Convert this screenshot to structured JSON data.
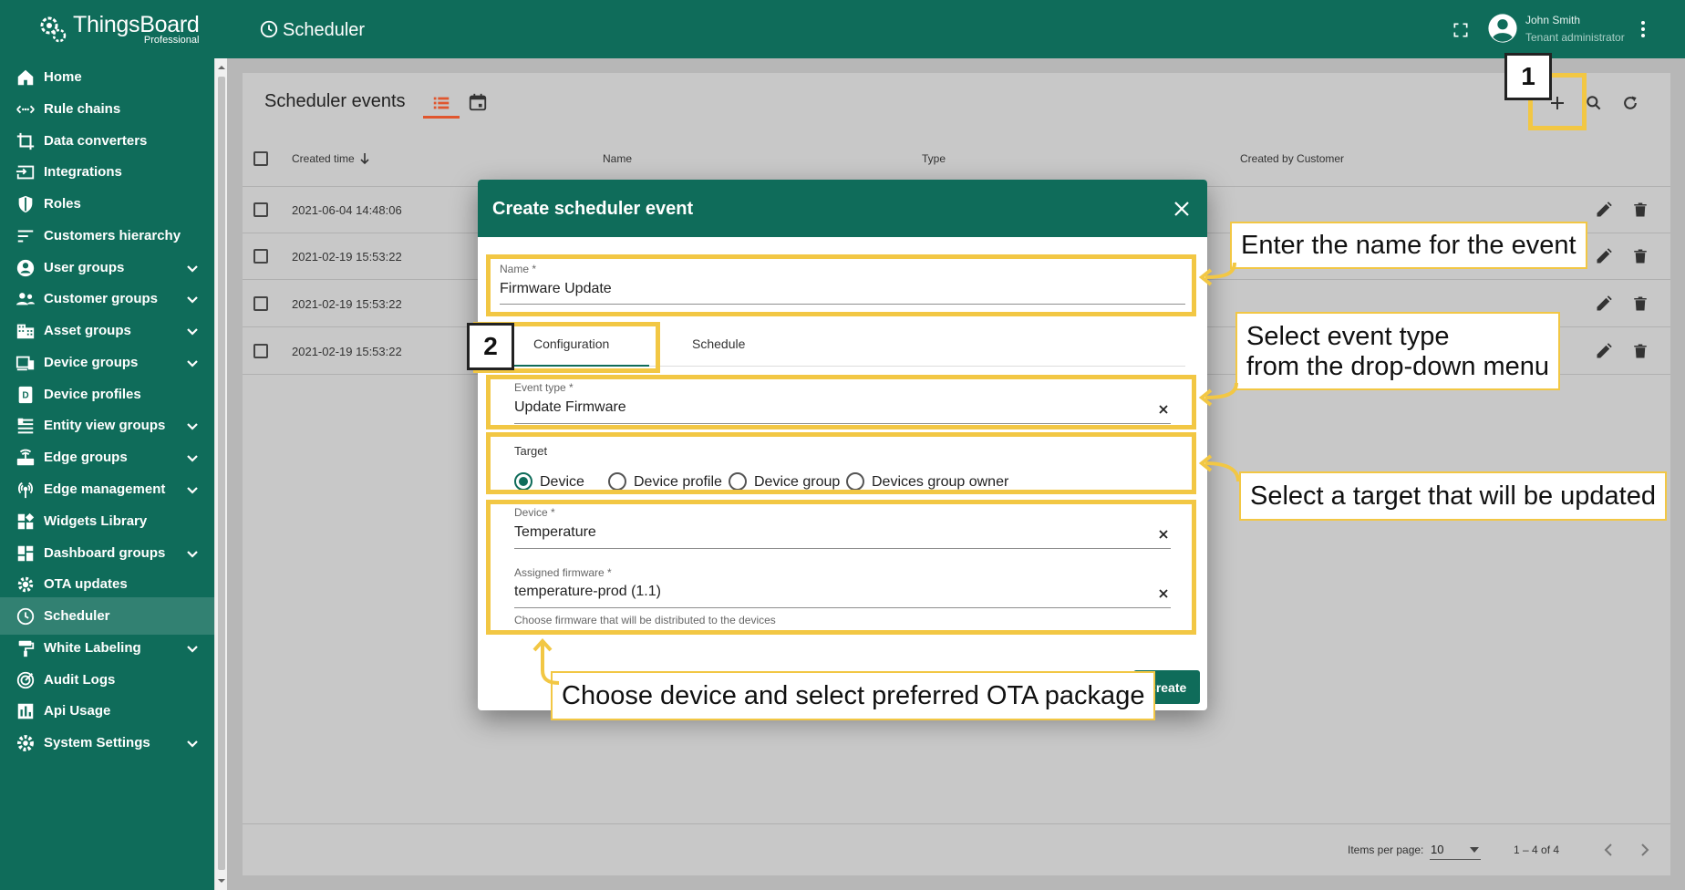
{
  "app": {
    "logo_name": "ThingsBoard",
    "logo_edition": "Professional",
    "page_title": "Scheduler",
    "user_name": "John Smith",
    "user_role": "Tenant administrator"
  },
  "sidebar": {
    "items": [
      {
        "label": "Home",
        "icon": "home-icon"
      },
      {
        "label": "Rule chains",
        "icon": "rule-chains-icon"
      },
      {
        "label": "Data converters",
        "icon": "crop-icon"
      },
      {
        "label": "Integrations",
        "icon": "input-icon"
      },
      {
        "label": "Roles",
        "icon": "shield-icon"
      },
      {
        "label": "Customers hierarchy",
        "icon": "sort-icon"
      },
      {
        "label": "User groups",
        "icon": "account-circle-icon"
      },
      {
        "label": "Customer groups",
        "icon": "supervisor-icon"
      },
      {
        "label": "Asset groups",
        "icon": "domain-icon"
      },
      {
        "label": "Device groups",
        "icon": "devices-icon"
      },
      {
        "label": "Device profiles",
        "icon": "device-profile-icon"
      },
      {
        "label": "Entity view groups",
        "icon": "view-quilt-icon"
      },
      {
        "label": "Edge groups",
        "icon": "router-icon"
      },
      {
        "label": "Edge management",
        "icon": "settings-input-antenna-icon"
      },
      {
        "label": "Widgets Library",
        "icon": "widgets-icon"
      },
      {
        "label": "Dashboard groups",
        "icon": "dashboard-icon"
      },
      {
        "label": "OTA updates",
        "icon": "gear-icon"
      },
      {
        "label": "Scheduler",
        "icon": "clock-icon"
      },
      {
        "label": "White Labeling",
        "icon": "format-paint-icon"
      },
      {
        "label": "Audit Logs",
        "icon": "track-changes-icon"
      },
      {
        "label": "Api Usage",
        "icon": "insert-chart-icon"
      },
      {
        "label": "System Settings",
        "icon": "settings-icon"
      }
    ]
  },
  "table": {
    "title": "Scheduler events",
    "columns": [
      "Created time",
      "Name",
      "Type",
      "Created by Customer"
    ],
    "rows": [
      {
        "created": "2021-06-04 14:48:06"
      },
      {
        "created": "2021-02-19 15:53:22"
      },
      {
        "created": "2021-02-19 15:53:22"
      },
      {
        "created": "2021-02-19 15:53:22"
      }
    ],
    "items_per_page_label": "Items per page:",
    "items_per_page": "10",
    "range": "1 – 4 of 4"
  },
  "dialog": {
    "title": "Create scheduler event",
    "name_label": "Name *",
    "name_value": "Firmware Update",
    "tabs": [
      "Configuration",
      "Schedule"
    ],
    "event_type_label": "Event type *",
    "event_type_value": "Update Firmware",
    "target_label": "Target",
    "target_options": [
      "Device",
      "Device profile",
      "Device group",
      "Devices group owner"
    ],
    "target_selected": "Device",
    "device_label": "Device *",
    "device_value": "Temperature",
    "firmware_label": "Assigned firmware *",
    "firmware_value": "temperature-prod (1.1)",
    "firmware_hint": "Choose firmware that will be distributed to the devices",
    "create_label": "Create"
  },
  "annotations": {
    "step1": "1",
    "step2": "2",
    "callout_name": "Enter the name for the event",
    "callout_type_line1": "Select event type",
    "callout_type_line2": "from the drop-down menu",
    "callout_target": "Select a target that will be updated",
    "callout_device": "Choose device and select preferred OTA package",
    "highlight_color": "#f2c744"
  },
  "colors": {
    "primary": "#0f6c5a",
    "accent": "#e0562e"
  }
}
